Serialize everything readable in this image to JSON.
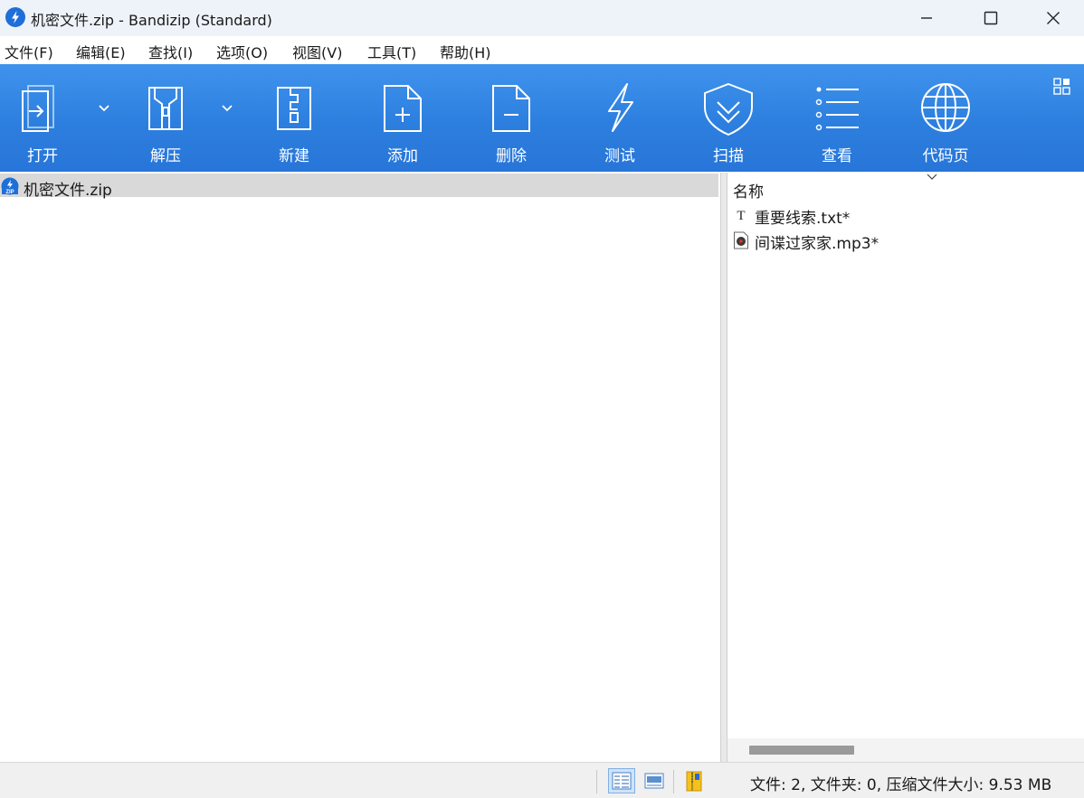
{
  "window": {
    "title": "机密文件.zip - Bandizip (Standard)"
  },
  "menu": [
    "文件(F)",
    "编辑(E)",
    "查找(I)",
    "选项(O)",
    "视图(V)",
    "工具(T)",
    "帮助(H)"
  ],
  "toolbar": {
    "open": "打开",
    "extract": "解压",
    "new": "新建",
    "add": "添加",
    "delete": "删除",
    "test": "测试",
    "scan": "扫描",
    "view": "查看",
    "codepage": "代码页"
  },
  "tree": {
    "root_label": "机密文件.zip"
  },
  "file_list": {
    "column_name": "名称",
    "files": [
      {
        "name": "重要线索.txt*",
        "icon": "text-file-icon"
      },
      {
        "name": "间谍过家家.mp3*",
        "icon": "audio-file-icon"
      }
    ]
  },
  "status": {
    "summary": "文件: 2, 文件夹: 0, 压缩文件大小: 9.53 MB"
  },
  "colors": {
    "toolbar_blue": "#2d7fdf",
    "selection_gray": "#d9d9d9",
    "title_bar": "#eef3fa"
  }
}
